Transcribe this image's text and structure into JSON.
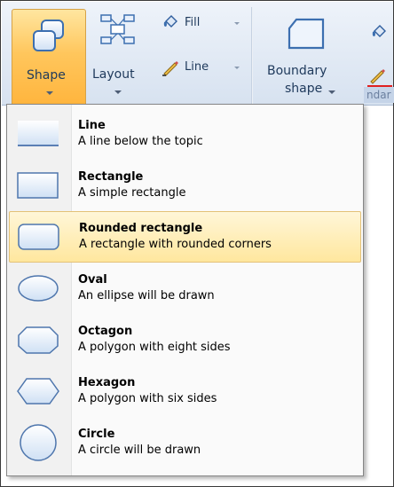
{
  "ribbon": {
    "shape_label": "Shape",
    "layout_label": "Layout",
    "fill_label": "Fill",
    "line_label": "Line",
    "boundary_label_1": "Boundary",
    "boundary_label_2": "shape",
    "group_caption_fragment": "ndar",
    "icons": {
      "shape": "shape-icon",
      "layout": "layout-icon",
      "fill": "paint-bucket-icon",
      "line": "pencil-icon",
      "boundary": "boundary-shape-icon"
    },
    "colors": {
      "shape_active": "#ffc65c",
      "line_swatch": "#e02020"
    }
  },
  "menu": {
    "selected_index": 2,
    "items": [
      {
        "title": "Line",
        "description": "A line below the topic",
        "icon": "line-shape-icon"
      },
      {
        "title": "Rectangle",
        "description": "A simple rectangle",
        "icon": "rectangle-shape-icon"
      },
      {
        "title": "Rounded rectangle",
        "description": "A rectangle with rounded corners",
        "icon": "rounded-rectangle-shape-icon"
      },
      {
        "title": "Oval",
        "description": "An ellipse will be drawn",
        "icon": "oval-shape-icon"
      },
      {
        "title": "Octagon",
        "description": "A polygon with eight sides",
        "icon": "octagon-shape-icon"
      },
      {
        "title": "Hexagon",
        "description": "A polygon with six sides",
        "icon": "hexagon-shape-icon"
      },
      {
        "title": "Circle",
        "description": "A circle will be drawn",
        "icon": "circle-shape-icon"
      }
    ]
  }
}
